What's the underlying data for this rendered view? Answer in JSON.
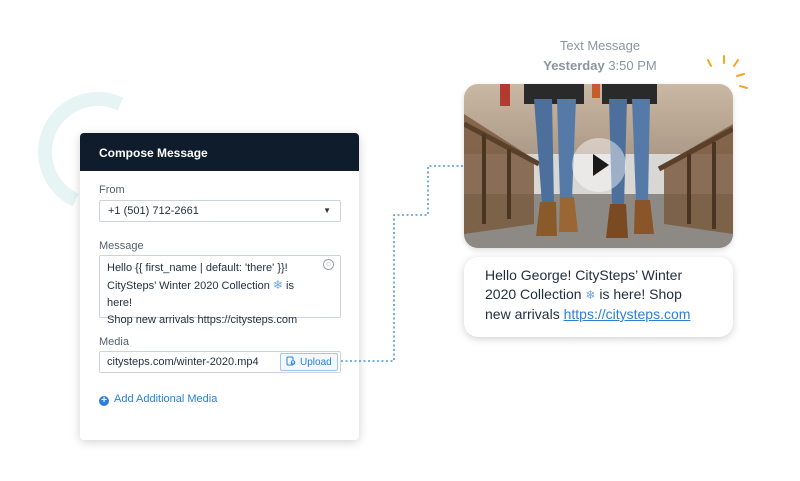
{
  "compose": {
    "title": "Compose Message",
    "from_label": "From",
    "from_value": "+1 (501) 712-2661",
    "message_label": "Message",
    "message_line1": "Hello {{ first_name | default: 'there' }}!",
    "message_line2_a": "CitySteps’ Winter 2020 Collection",
    "message_line2_b": "is here!",
    "message_line3": "Shop new arrivals https://citysteps.com",
    "media_label": "Media",
    "media_value": "citysteps.com/winter-2020.mp4",
    "upload_label": "Upload",
    "add_media_label": "Add Additional Media"
  },
  "preview": {
    "header_title": "Text Message",
    "header_day": "Yesterday",
    "header_time": "3:50 PM",
    "bubble_line1": "Hello George! CitySteps’ Winter",
    "bubble_line2_a": "2020 Collection",
    "bubble_line2_b": "is here! Shop",
    "bubble_line3_a": "new arrivals",
    "bubble_link": "https://citysteps.com"
  },
  "icons": {
    "emoji": "smiley-icon",
    "snowflake": "snowflake-icon",
    "upload": "upload-icon",
    "plus": "plus-circle-icon",
    "play": "play-icon"
  },
  "colors": {
    "header_bg": "#0f1c2c",
    "accent": "#2b7fd6",
    "spark": "#f5a623"
  }
}
